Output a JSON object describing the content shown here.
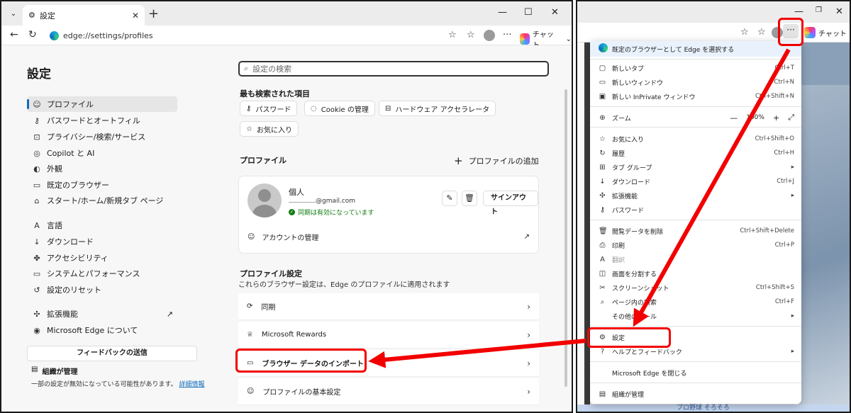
{
  "left": {
    "tab_title": "設定",
    "url": "edge://settings/profiles",
    "copilot_label": "チャット",
    "title": "設定",
    "sidebar_items": [
      {
        "label": "プロファイル",
        "icon": "profile-icon",
        "glyph": "☺"
      },
      {
        "label": "パスワードとオートフィル",
        "icon": "key-icon",
        "glyph": "⚷"
      },
      {
        "label": "プライバシー/検索/サービス",
        "icon": "lock-icon",
        "glyph": "⊡"
      },
      {
        "label": "Copilot と AI",
        "icon": "copilot-icon",
        "glyph": "◎"
      },
      {
        "label": "外観",
        "icon": "appearance-icon",
        "glyph": "◐"
      },
      {
        "label": "既定のブラウザー",
        "icon": "browser-icon",
        "glyph": "▭"
      },
      {
        "label": "スタート/ホーム/新規タブ ページ",
        "icon": "home-icon",
        "glyph": "⌂"
      },
      {
        "label": "言語",
        "icon": "language-icon",
        "glyph": "A"
      },
      {
        "label": "ダウンロード",
        "icon": "download-icon",
        "glyph": "↓"
      },
      {
        "label": "アクセシビリティ",
        "icon": "accessibility-icon",
        "glyph": "✤"
      },
      {
        "label": "システムとパフォーマンス",
        "icon": "system-icon",
        "glyph": "▭"
      },
      {
        "label": "設定のリセット",
        "icon": "reset-icon",
        "glyph": "↺"
      },
      {
        "label": "拡張機能",
        "icon": "extensions-icon",
        "glyph": "✣"
      },
      {
        "label": "Microsoft Edge について",
        "icon": "edge-icon",
        "glyph": "◉"
      }
    ],
    "feedback_label": "フィードバックの送信",
    "org_label": "組織が管理",
    "org_note": "一部の設定が無効になっている可能性があります。",
    "org_link": "詳細情報",
    "search_placeholder": "設定の検索",
    "most_searched_title": "最も検索された項目",
    "chips": [
      "パスワード",
      "Cookie の管理",
      "ハードウェア アクセラレータ",
      "お気に入り"
    ],
    "profile_section_title": "プロファイル",
    "add_profile_label": "プロファイルの追加",
    "profile": {
      "name": "個人",
      "email_suffix": "@gmail.com",
      "sync_status": "同期は有効になっています",
      "signout_label": "サインアウト",
      "account_manage_label": "アカウントの管理"
    },
    "profile_settings_title": "プロファイル設定",
    "profile_settings_subtitle": "これらのブラウザー設定は、Edge のプロファイルに適用されます",
    "settings_rows": [
      "同期",
      "Microsoft Rewards",
      "ブラウザー データのインポート",
      "プロファイルの基本設定"
    ]
  },
  "right": {
    "copilot_label": "チャット",
    "more_button": "···",
    "page_bottom_text": "プロ野球 そろそろ",
    "menu": {
      "default_browser": "既定のブラウザーとして Edge を選択する",
      "items": [
        {
          "label": "新しいタブ",
          "shortcut": "Ctrl+T",
          "icon": "new-tab-icon",
          "glyph": "▢"
        },
        {
          "label": "新しいウィンドウ",
          "shortcut": "Ctrl+N",
          "icon": "new-window-icon",
          "glyph": "▭"
        },
        {
          "label": "新しい InPrivate ウィンドウ",
          "shortcut": "Ctrl+Shift+N",
          "icon": "inprivate-icon",
          "glyph": "▣"
        },
        {
          "label": "ズーム",
          "shortcut": "",
          "icon": "zoom-icon",
          "glyph": "⊕"
        },
        {
          "label": "お気に入り",
          "shortcut": "Ctrl+Shift+O",
          "icon": "favorites-icon",
          "glyph": "☆"
        },
        {
          "label": "履歴",
          "shortcut": "Ctrl+H",
          "icon": "history-icon",
          "glyph": "↻"
        },
        {
          "label": "タブ グループ",
          "shortcut": "▸",
          "icon": "tab-groups-icon",
          "glyph": "⊞"
        },
        {
          "label": "ダウンロード",
          "shortcut": "Ctrl+J",
          "icon": "download-icon",
          "glyph": "↓"
        },
        {
          "label": "拡張機能",
          "shortcut": "▸",
          "icon": "extensions-icon",
          "glyph": "✣"
        },
        {
          "label": "パスワード",
          "shortcut": "",
          "icon": "key-icon",
          "glyph": "⚷"
        },
        {
          "label": "閲覧データを削除",
          "shortcut": "Ctrl+Shift+Delete",
          "icon": "delete-icon",
          "glyph": "🗑"
        },
        {
          "label": "印刷",
          "shortcut": "Ctrl+P",
          "icon": "print-icon",
          "glyph": "⎙"
        },
        {
          "label": "翻訳",
          "shortcut": "",
          "icon": "translate-icon",
          "glyph": "A"
        },
        {
          "label": "画面を分割する",
          "shortcut": "",
          "icon": "split-screen-icon",
          "glyph": "◫"
        },
        {
          "label": "スクリーンショット",
          "shortcut": "Ctrl+Shift+S",
          "icon": "screenshot-icon",
          "glyph": "✂"
        },
        {
          "label": "ページ内の検索",
          "shortcut": "Ctrl+F",
          "icon": "find-icon",
          "glyph": "⌕"
        },
        {
          "label": "その他のツール",
          "shortcut": "▸",
          "icon": "",
          "glyph": ""
        },
        {
          "label": "設定",
          "shortcut": "",
          "icon": "gear-icon",
          "glyph": "⚙"
        },
        {
          "label": "ヘルプとフィードバック",
          "shortcut": "▸",
          "icon": "help-icon",
          "glyph": "?"
        },
        {
          "label": "Microsoft Edge を閉じる",
          "shortcut": "",
          "icon": "",
          "glyph": ""
        },
        {
          "label": "組織が管理",
          "shortcut": "",
          "icon": "organization-icon",
          "glyph": "▤"
        }
      ],
      "zoom_value": "100%"
    }
  },
  "colors": {
    "highlight": "#f20000",
    "accent": "#0f6cbd",
    "sync_green": "#107c10"
  }
}
